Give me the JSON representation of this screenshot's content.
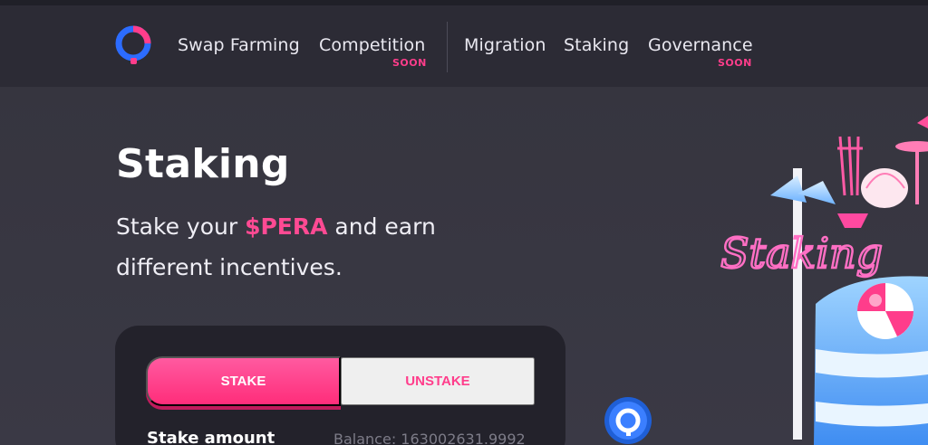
{
  "nav": {
    "items": [
      {
        "label": "Swap Farming"
      },
      {
        "label": "Competition",
        "badge": "SOON"
      },
      {
        "label": "Migration"
      },
      {
        "label": "Staking"
      },
      {
        "label": "Governance",
        "badge": "SOON"
      }
    ]
  },
  "hero": {
    "title": "Staking",
    "subtitle_prefix": "Stake your ",
    "subtitle_token": "$PERA",
    "subtitle_suffix": " and earn different incentives.",
    "illustration_text": "Staking"
  },
  "stake_card": {
    "tabs": [
      {
        "label": "STAKE",
        "active": true
      },
      {
        "label": "UNSTAKE",
        "active": false
      }
    ],
    "amount_label": "Stake amount",
    "balance_text": "Balance: 163002631.9992"
  },
  "colors": {
    "accent": "#ff3d8b",
    "background": "#3a3945",
    "nav_background": "#2c2b35",
    "card_background": "#23222b"
  },
  "icons": {
    "logo": "pera-logo-icon",
    "coin": "pera-coin-icon"
  }
}
